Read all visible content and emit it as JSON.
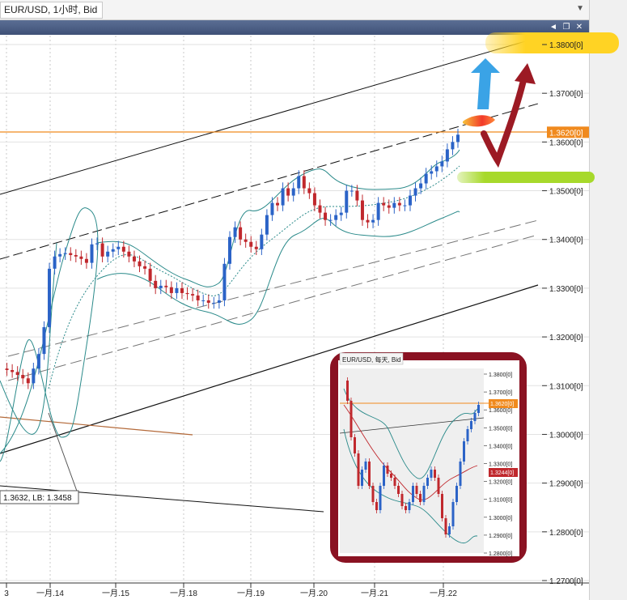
{
  "window": {
    "title": "EUR/USD, 1小时, Bid",
    "buttons": [
      "pin-icon",
      "restore-icon",
      "close-icon"
    ]
  },
  "chart_data": {
    "type": "line",
    "symbol": "EUR/USD",
    "timeframe": "1小时",
    "price_type": "Bid",
    "x_tick_labels": [
      "3",
      "一月.14",
      "一月.15",
      "一月.18",
      "一月.19",
      "一月.20",
      "一月.21",
      "一月.22"
    ],
    "y_tick_labels": [
      "1.3800[0]",
      "1.3700[0]",
      "1.3600[0]",
      "1.3500[0]",
      "1.3400[0]",
      "1.3300[0]",
      "1.3200[0]",
      "1.3100[0]",
      "1.3000[0]",
      "1.2900[0]",
      "1.2800[0]",
      "1.2700[0]"
    ],
    "ylim": [
      1.268,
      1.386
    ],
    "current_price_label": "1.3620[0]",
    "current_price": 1.362,
    "series": [
      {
        "values": [
          1.3135,
          1.3132,
          1.3128,
          1.3122,
          1.3115,
          1.3105,
          1.3135,
          1.3165,
          1.322,
          1.334,
          1.3365,
          1.337,
          1.3372,
          1.3368,
          1.3365,
          1.336,
          1.3352,
          1.339,
          1.3392,
          1.3365,
          1.3375,
          1.338,
          1.3385,
          1.3375,
          1.3365,
          1.3355,
          1.3345,
          1.334,
          1.3315,
          1.33,
          1.3305,
          1.3302,
          1.329,
          1.33,
          1.329,
          1.3288,
          1.3285,
          1.3275,
          1.3275,
          1.327,
          1.327,
          1.3275,
          1.335,
          1.3405,
          1.3425,
          1.34,
          1.3395,
          1.3385,
          1.338,
          1.341,
          1.345,
          1.3475,
          1.347,
          1.3505,
          1.349,
          1.3505,
          1.353,
          1.3505,
          1.3495,
          1.347,
          1.3455,
          1.344,
          1.344,
          1.345,
          1.3455,
          1.35,
          1.35,
          1.348,
          1.344,
          1.3435,
          1.344,
          1.3475,
          1.347,
          1.3465,
          1.3475,
          1.347,
          1.347,
          1.349,
          1.3505,
          1.3515,
          1.3535,
          1.354,
          1.355,
          1.356,
          1.3585,
          1.36,
          1.3615
        ]
      }
    ],
    "channel_label": "1.3632, LB: 1.3458",
    "inset": {
      "title": "EUR/USD, 每天, Bid",
      "y_tick_labels": [
        "1.3800[0]",
        "1.3700[0]",
        "1.3600[0]",
        "1.3500[0]",
        "1.3400[0]",
        "1.3300[0]",
        "1.3200[0]",
        "1.3100[0]",
        "1.3000[0]",
        "1.2900[0]",
        "1.2800[0]"
      ],
      "current_price_label": "1.3620[0]",
      "marker_label": "1.3244[0]"
    },
    "colors": {
      "background": "#ffffff",
      "up_candle": "#2b63c7",
      "down_candle": "#c0282d",
      "bollinger": "#2a8a8a",
      "current_price_line": "#f08a1e",
      "arrow_up": "#3aa3e6",
      "arrow_down": "#9c1a24",
      "highlight_yellow": "#ffd324",
      "highlight_green": "#a7d92b",
      "inset_frame": "#8a1222"
    }
  }
}
